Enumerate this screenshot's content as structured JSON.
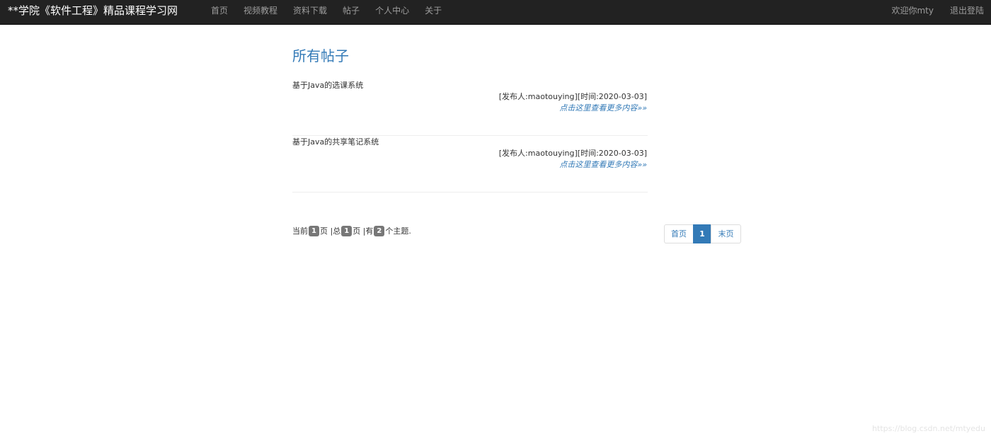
{
  "navbar": {
    "brand": "**学院《软件工程》精品课程学习网",
    "items": [
      "首页",
      "视频教程",
      "资料下载",
      "帖子",
      "个人中心",
      "关于"
    ],
    "welcome": "欢迎你mty",
    "logout": "退出登陆"
  },
  "main": {
    "title": "所有帖子",
    "posts": [
      {
        "title": "基于Java的选课系统",
        "meta": "[发布人:maotouying][时间:2020-03-03]",
        "more": "点击这里查看更多内容»»"
      },
      {
        "title": "基于Java的共享笔记系统",
        "meta": "[发布人:maotouying][时间:2020-03-03]",
        "more": "点击这里查看更多内容»»"
      }
    ]
  },
  "page_info": {
    "prefix_current": "当前",
    "current": "1",
    "suffix_current": "页 |总",
    "total": "1",
    "suffix_total": "页 |有",
    "count": "2",
    "suffix_count": "个主题."
  },
  "pagination": {
    "first": "首页",
    "current": "1",
    "last": "末页"
  },
  "watermark": "https://blog.csdn.net/mtyedu",
  "colors": {
    "navbar_bg": "#222222",
    "link": "#337ab7",
    "badge": "#777777"
  }
}
